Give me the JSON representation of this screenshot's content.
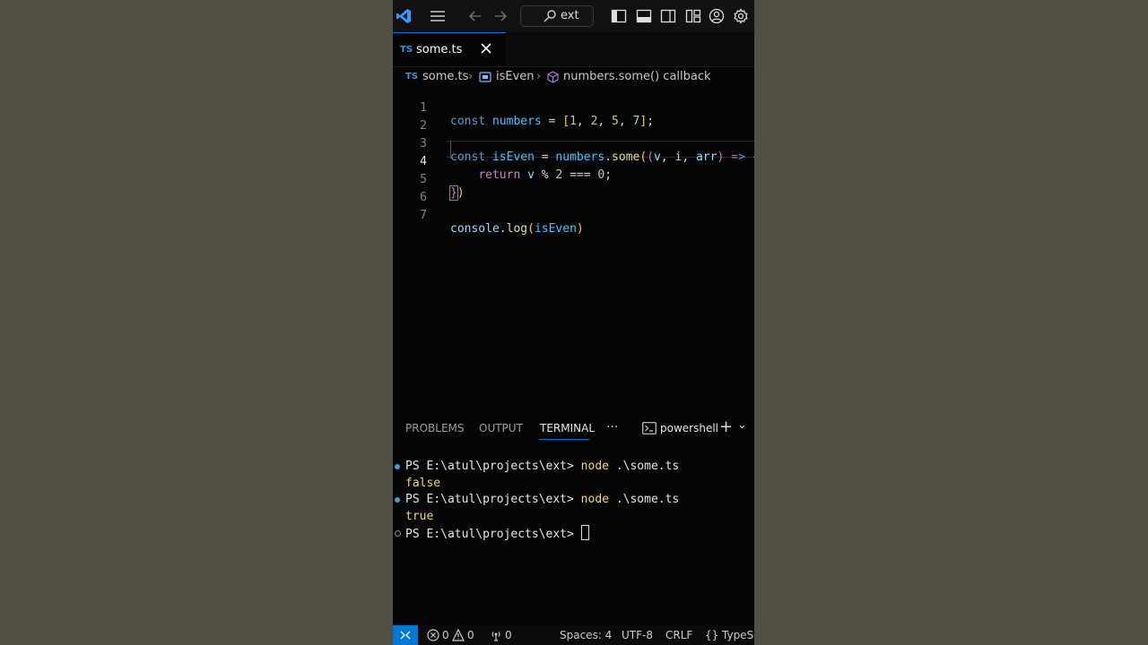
{
  "colors": {
    "accent": "#0078d4",
    "backdrop": "#524f44",
    "editor_bg": "#050505"
  },
  "titlebar": {
    "search_text": "ext",
    "icons": [
      "vscode-logo-icon",
      "menu-icon",
      "back-arrow-icon",
      "forward-arrow-icon",
      "search-icon",
      "toggle-primary-sidebar-icon",
      "toggle-panel-icon",
      "toggle-secondary-sidebar-icon",
      "customize-layout-icon",
      "accounts-icon",
      "settings-gear-icon"
    ]
  },
  "tab": {
    "badge": "TS",
    "name": "some.ts"
  },
  "breadcrumb": {
    "file_badge": "TS",
    "file": "some.ts",
    "sep": "›",
    "symbol1": "isEven",
    "symbol2": "numbers.some() callback"
  },
  "editor": {
    "current_line": 4,
    "lines": [
      {
        "n": "1"
      },
      {
        "n": "2"
      },
      {
        "n": "3"
      },
      {
        "n": "4"
      },
      {
        "n": "5"
      },
      {
        "n": "6"
      },
      {
        "n": "7"
      }
    ]
  },
  "panel": {
    "tabs": [
      "PROBLEMS",
      "OUTPUT",
      "TERMINAL"
    ],
    "more": "···",
    "terminal_name": "powershell",
    "add": "+",
    "chevron": "⌄"
  },
  "terminal": {
    "prompt": "PS E:\\atul\\projects\\ext>",
    "cmd_node": "node",
    "cmd_arg": ".\\some.ts",
    "out1": "false",
    "out2": "true"
  },
  "statusbar": {
    "errors": "0",
    "warnings": "0",
    "ports": "0",
    "spaces": "Spaces: 4",
    "encoding": "UTF-8",
    "eol": "CRLF",
    "language_braces": "{}",
    "language": "TypeScript"
  }
}
